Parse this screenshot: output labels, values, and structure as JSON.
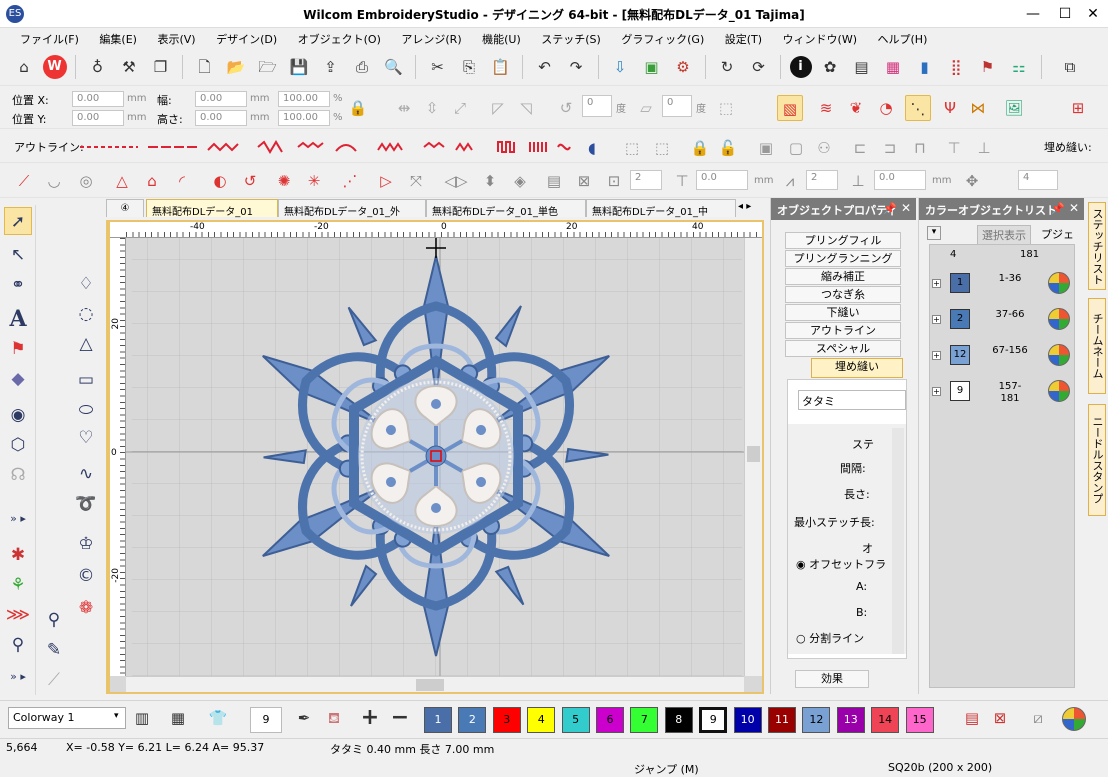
{
  "window": {
    "title": "Wilcom EmbroideryStudio - デザイニング 64-bit - [無料配布DLデータ_01        Tajima]"
  },
  "menu": [
    "ファイル(F)",
    "編集(E)",
    "表示(V)",
    "デザイン(D)",
    "オブジェクト(O)",
    "アレンジ(R)",
    "機能(U)",
    "ステッチ(S)",
    "グラフィック(G)",
    "設定(T)",
    "ウィンドウ(W)",
    "ヘルプ(H)"
  ],
  "position": {
    "x_label": "位置 X:",
    "y_label": "位置 Y:",
    "width_label": "幅:",
    "height_label": "高さ:",
    "x": "0.00",
    "y": "0.00",
    "w": "0.00",
    "h": "0.00",
    "unit": "mm",
    "scale_x": "100.00",
    "scale_y": "100.00",
    "pct": "%",
    "rot": "0",
    "rot_unit": "度",
    "skew": "0",
    "skew_unit": "度"
  },
  "outline_label": "アウトライン:",
  "fill_label": "埋め縫い:",
  "stitch_params": {
    "v1": "2",
    "v2": "0.0",
    "unit1": "mm",
    "v3": "2",
    "v4": "0.0",
    "unit2": "mm",
    "v5": "4"
  },
  "tabs": [
    "④",
    "無料配布DLデータ_01",
    "無料配布DLデータ_01_外",
    "無料配布DLデータ_01_単色",
    "無料配布DLデータ_01_中"
  ],
  "ruler": {
    "x_ticks": [
      "-40",
      "-20",
      "0",
      "20",
      "40"
    ],
    "y_ticks": [
      "20",
      "0",
      "-20"
    ]
  },
  "properties": {
    "title": "オブジェクトプロパティ",
    "buttons": [
      "プリングフィル",
      "プリングランニング",
      "縮み補正",
      "つなぎ糸",
      "下縫い",
      "アウトライン",
      "スペシャル",
      "埋め縫い"
    ],
    "fill_type": "タタミ",
    "fields": [
      "ステ",
      "間隔:",
      "長さ:",
      "最小ステッチ長:",
      "オ"
    ],
    "offset_label": "オフセットフラ",
    "a_label": "A:",
    "b_label": "B:",
    "split_label": "分割ライン",
    "effects": "効果"
  },
  "colorlist": {
    "title": "カラーオブジェクトリスト",
    "view_btn": "選択表示",
    "column": "プジェク",
    "top_row": {
      "n": "4",
      "range": "181"
    },
    "rows": [
      {
        "chip": "1",
        "color": "#4a6fa8",
        "range": "1-36"
      },
      {
        "chip": "2",
        "color": "#4a7ab5",
        "range": "37-66"
      },
      {
        "chip": "12",
        "color": "#7aa1d4",
        "range": "67-156"
      },
      {
        "chip": "9",
        "color": "#ffffff",
        "range": "157-181"
      }
    ]
  },
  "right_tabs": [
    "ステッチリスト",
    "チームネーム",
    "ニードルスタンプ"
  ],
  "bottom": {
    "colorway": "Colorway 1",
    "current_color": "9",
    "swatches": [
      {
        "label": "1",
        "color": "#4a6fa8"
      },
      {
        "label": "2",
        "color": "#4a7ab5"
      },
      {
        "label": "3",
        "color": "#ff0000"
      },
      {
        "label": "4",
        "color": "#ffff00"
      },
      {
        "label": "5",
        "color": "#33cccc"
      },
      {
        "label": "6",
        "color": "#cc00cc"
      },
      {
        "label": "7",
        "color": "#33ff33"
      },
      {
        "label": "8",
        "color": "#000000"
      },
      {
        "label": "9",
        "color": "#ffffff"
      },
      {
        "label": "10",
        "color": "#0000aa"
      },
      {
        "label": "11",
        "color": "#990000"
      },
      {
        "label": "12",
        "color": "#7aa1d4"
      },
      {
        "label": "13",
        "color": "#9900aa"
      },
      {
        "label": "14",
        "color": "#ee4455"
      },
      {
        "label": "15",
        "color": "#ff66cc"
      }
    ]
  },
  "status": {
    "count": "5,664",
    "coords": "X=  -0.58 Y=   6.21 L=   6.24 A=  95.37",
    "stitch": "タタミ  0.40 mm 長さ  7.00 mm",
    "jump": "ジャンプ (M)",
    "hoop": "SQ20b (200 x 200)"
  }
}
